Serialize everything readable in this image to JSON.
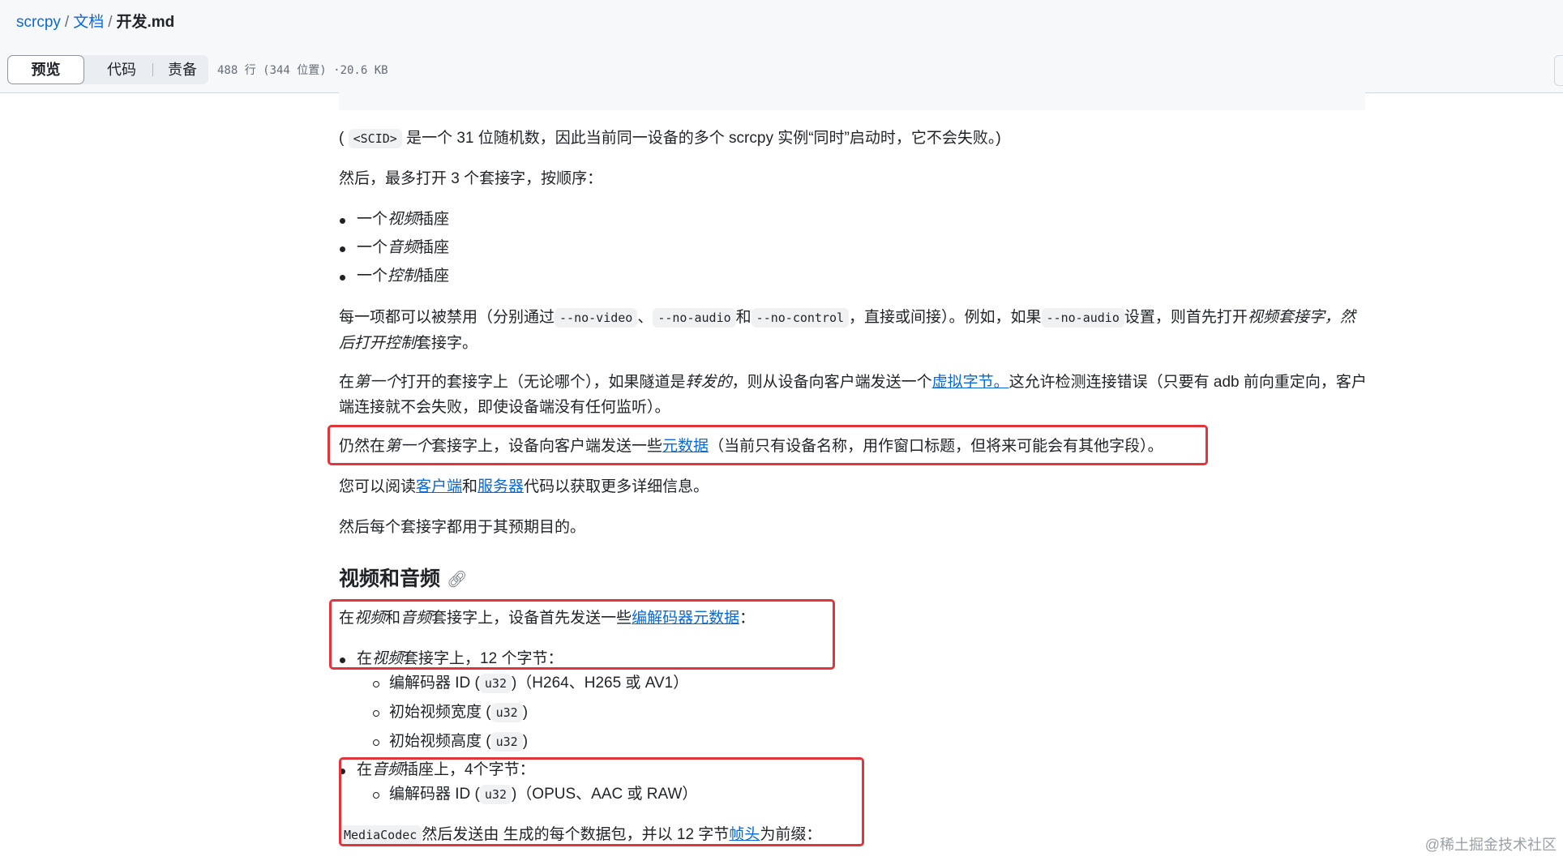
{
  "breadcrumb": {
    "repo": "scrcpy",
    "folder": "文档",
    "file": "开发.md",
    "sep": "/"
  },
  "toolbar": {
    "preview_label": "预览",
    "code_label": "代码",
    "blame_label": "责备",
    "file_info": "488 行 (344 位置) ·20.6 KB"
  },
  "content": {
    "p1": {
      "pre": "(",
      "code": "<SCID>",
      "post": "是一个 31 位随机数，因此当前同一设备的多个 scrcpy 实例“同时”启动时，它不会失败。)"
    },
    "p2": "然后，最多打开 3 个套接字，按顺序：",
    "sockets": [
      {
        "pre": "一个",
        "em": "视频",
        "post": "插座"
      },
      {
        "pre": "一个",
        "em": "音频",
        "post": "插座"
      },
      {
        "pre": "一个",
        "em": "控制",
        "post": "插座"
      }
    ],
    "p3": {
      "t1": "每一项都可以被禁用（分别通过",
      "c1": "--no-video",
      "t2": "、",
      "c2": "--no-audio",
      "t3": "和",
      "c3": "--no-control",
      "t4": "，直接或间接）。例如，如果",
      "c4": "--no-audio",
      "t5": "设置，则首先打开",
      "em1": "视频套接字，然后打开控制",
      "t6": "套接字。"
    },
    "p4": {
      "t1": "在",
      "em1": "第一个",
      "t2": "打开的套接字上（无论哪个），如果隧道是",
      "em2": "转发的",
      "t3": "，则从设备向客户端发送一个",
      "link": "虚拟字节。",
      "t4": "这允许检测连接错误（只要有 adb 前向重定向，客户端连接就不会失败，即使设备端没有任何监听）。"
    },
    "p5": {
      "t1": "仍然在",
      "em1": "第一个",
      "t2": "套接字上，设备向客户端发送一些",
      "link": "元数据",
      "t3": "（当前只有设备名称，用作窗口标题，但将来可能会有其他字段）。"
    },
    "p6": {
      "t1": "您可以阅读",
      "link1": "客户端",
      "t2": "和",
      "link2": "服务器",
      "t3": "代码以获取更多详细信息。"
    },
    "p7": "然后每个套接字都用于其预期目的。",
    "h2": "视频和音频",
    "p8": {
      "t1": "在",
      "em1": "视频",
      "t2": "和",
      "em2": "音频",
      "t3": "套接字上，设备首先发送一些",
      "link": "编解码器元数据",
      "t4": "："
    },
    "video": {
      "pre": "在",
      "em": "视频",
      "post": "套接字上，12 个字节：",
      "items": [
        {
          "t": "编解码器 ID (",
          "code": "u32",
          "post": ")（H264、H265 或 AV1）"
        },
        {
          "t": "初始视频宽度 (",
          "code": "u32",
          "post": ")"
        },
        {
          "t": "初始视频高度 (",
          "code": "u32",
          "post": ")"
        }
      ]
    },
    "audio": {
      "pre": "在",
      "em": "音频",
      "post": "插座上，4个字节：",
      "items": [
        {
          "t": "编解码器 ID (",
          "code": "u32",
          "post": ")（OPUS、AAC 或 RAW）"
        }
      ]
    },
    "p9": {
      "code": "MediaCodec",
      "t1": "然后发送由 生成的每个数据包，并以 12 字节",
      "link": "帧头",
      "t2": "为前缀："
    }
  },
  "watermark": "@稀土掘金技术社区",
  "colors": {
    "link": "#0969da",
    "highlight_box": "#e0363b",
    "header_bg": "#f6f8fa"
  },
  "icons": {
    "anchor": "link-icon"
  }
}
